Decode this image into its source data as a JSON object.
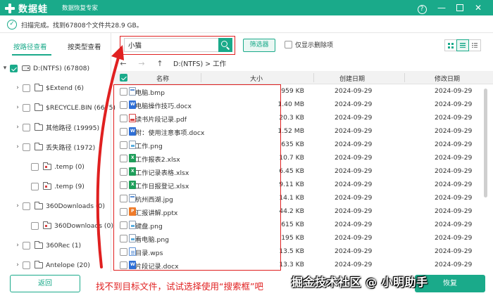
{
  "app": {
    "name": "数据蛙",
    "subtitle": "数据恢复专家"
  },
  "window_controls": {
    "help": "?",
    "minimize": "—",
    "close": "✕"
  },
  "status": {
    "message": "扫描完成。找到67808个文件共28.9 GB。",
    "check": "✓"
  },
  "left": {
    "tabs": [
      {
        "label": "按路径查看",
        "active": true
      },
      {
        "label": "按类型查看",
        "active": false
      }
    ],
    "tree": [
      {
        "arrow": "▾",
        "label": "D:(NTFS) (67808)",
        "checked": true,
        "icon": "drive-icon"
      },
      {
        "arrow": "›",
        "label": "$Extend (6)",
        "checked": false,
        "icon": "folder-icon"
      },
      {
        "arrow": "›",
        "label": "$RECYCLE.BIN (6675)",
        "checked": false,
        "icon": "folder-icon"
      },
      {
        "arrow": "›",
        "label": "其他路径 (19995)",
        "checked": false,
        "icon": "folder-icon"
      },
      {
        "arrow": "›",
        "label": "丢失路径 (1972)",
        "checked": false,
        "icon": "folder-icon"
      },
      {
        "arrow": "",
        "label": ".temp (0)",
        "checked": false,
        "icon": "folder-icon-red"
      },
      {
        "arrow": "",
        "label": ".temp (9)",
        "checked": false,
        "icon": "folder-icon-red"
      },
      {
        "arrow": "›",
        "label": "360Downloads (0)",
        "checked": false,
        "icon": "folder-icon"
      },
      {
        "arrow": "",
        "label": "360Downloads (0)",
        "checked": false,
        "icon": "folder-icon-red"
      },
      {
        "arrow": "›",
        "label": "360Rec (1)",
        "checked": false,
        "icon": "folder-icon"
      },
      {
        "arrow": "›",
        "label": "Antelope (20)",
        "checked": false,
        "icon": "folder-icon"
      }
    ],
    "back_label": "返回"
  },
  "search": {
    "value": "小猫",
    "filter_label": "筛选器",
    "deleted_only_label": "仅显示删除项"
  },
  "nav": {
    "back": "←",
    "forward": "→",
    "up": "↑",
    "path": "D:(NTFS) > 工作"
  },
  "table": {
    "headers": {
      "name": "名称",
      "size": "大小",
      "created": "创建日期",
      "modified": "修改日期"
    },
    "rows": [
      {
        "name": "电脑.bmp",
        "size": "959 KB",
        "created": "2024-09-29",
        "modified": "2024-09-29",
        "icon": "bmp-icon"
      },
      {
        "name": "电脑操作技巧.docx",
        "size": "1.40 MB",
        "created": "2024-09-29",
        "modified": "2024-09-29",
        "icon": "word-icon"
      },
      {
        "name": "读书片段记录.pdf",
        "size": "20.3 KB",
        "created": "2024-09-29",
        "modified": "2024-09-29",
        "icon": "pdf-icon"
      },
      {
        "name": "附：使用注意事项.docx",
        "size": "1.52 MB",
        "created": "2024-09-29",
        "modified": "2024-09-29",
        "icon": "word-icon"
      },
      {
        "name": "工作.png",
        "size": "635 KB",
        "created": "2024-09-29",
        "modified": "2024-09-29",
        "icon": "image-icon"
      },
      {
        "name": "工作报表2.xlsx",
        "size": "10.7 KB",
        "created": "2024-09-29",
        "modified": "2024-09-29",
        "icon": "excel-icon"
      },
      {
        "name": "工作记录表格.xlsx",
        "size": "6.45 KB",
        "created": "2024-09-29",
        "modified": "2024-09-29",
        "icon": "excel-icon"
      },
      {
        "name": "工作日报登记.xlsx",
        "size": "9.11 KB",
        "created": "2024-09-29",
        "modified": "2024-09-29",
        "icon": "excel-icon"
      },
      {
        "name": "杭州西湖.jpg",
        "size": "14.1 KB",
        "created": "2024-09-29",
        "modified": "2024-09-29",
        "icon": "bmp-icon"
      },
      {
        "name": "汇报讲解.pptx",
        "size": "44.2 KB",
        "created": "2024-09-29",
        "modified": "2024-09-29",
        "icon": "ppt-icon"
      },
      {
        "name": "键盘.png",
        "size": "615 KB",
        "created": "2024-09-29",
        "modified": "2024-09-29",
        "icon": "image-icon"
      },
      {
        "name": "看电脑.png",
        "size": "195 KB",
        "created": "2024-09-29",
        "modified": "2024-09-29",
        "icon": "image-icon"
      },
      {
        "name": "目录.wps",
        "size": "13.5 KB",
        "created": "2024-09-29",
        "modified": "2024-09-29",
        "icon": "wps-icon"
      },
      {
        "name": "片段记录.docx",
        "size": "13.3 KB",
        "created": "2024-09-29",
        "modified": "2024-09-29",
        "icon": "word-icon"
      }
    ]
  },
  "bottom": {
    "tip": "找不到目标文件，试试选择使用“搜索框”吧",
    "watermark": "掘金技术社区 @ 小明助手",
    "recover_label": "恢复"
  },
  "colors": {
    "accent": "#1aaa8a",
    "highlight": "#e02020"
  }
}
